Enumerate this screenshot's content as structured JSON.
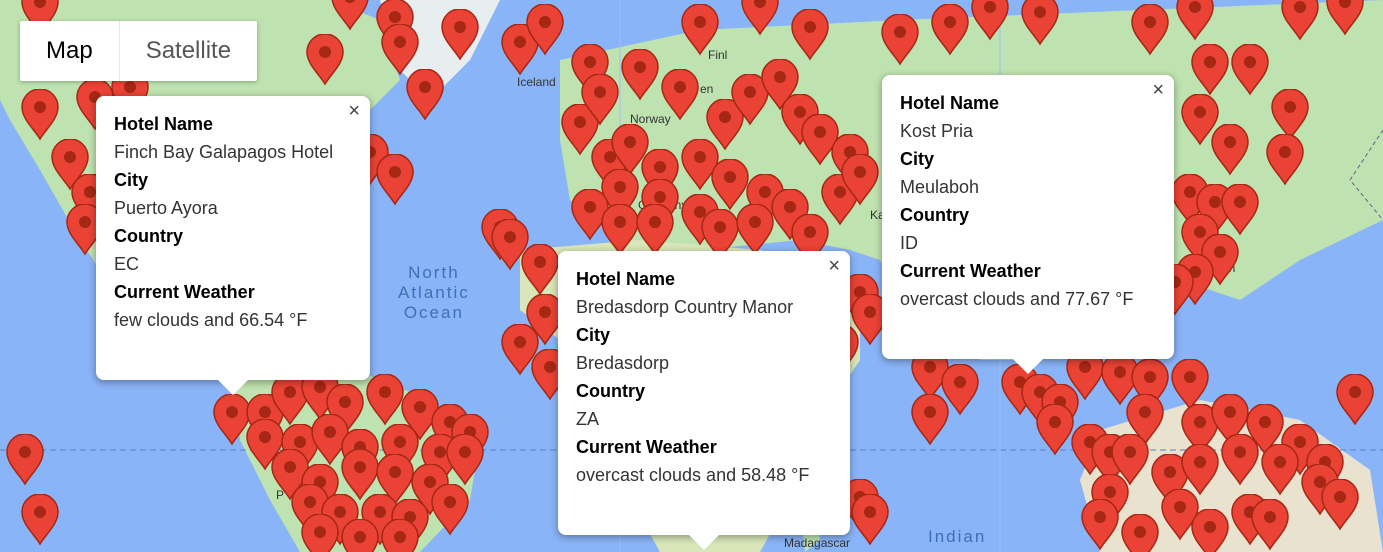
{
  "map_type": {
    "map_label": "Map",
    "satellite_label": "Satellite"
  },
  "labels": {
    "north_atlantic": [
      "North",
      "Atlantic",
      "Ocean"
    ],
    "indian": "Indian",
    "iceland": "Iceland",
    "norway": "Norway",
    "germany": "Germany",
    "madagascar": "Madagascar",
    "finland": "Finl",
    "sweden": "en",
    "kaz": "Ka",
    "china": "an",
    "peru": "P"
  },
  "colors": {
    "water": "#8ab4f8",
    "land": "#bfe3b0",
    "land_dry": "#e8e2cf",
    "marker": "#ea4335",
    "marker_dark": "#a52714"
  },
  "info_windows": [
    {
      "hotel_label": "Hotel Name",
      "hotel": "Finch Bay Galapagos Hotel",
      "city_label": "City",
      "city": "Puerto Ayora",
      "country_label": "Country",
      "country": "EC",
      "weather_label": "Current Weather",
      "weather": "few clouds and 66.54 °F",
      "close": "×"
    },
    {
      "hotel_label": "Hotel Name",
      "hotel": "Bredasdorp Country Manor",
      "city_label": "City",
      "city": "Bredasdorp",
      "country_label": "Country",
      "country": "ZA",
      "weather_label": "Current Weather",
      "weather": "overcast clouds and 58.48 °F",
      "close": "×"
    },
    {
      "hotel_label": "Hotel Name",
      "hotel": "Kost Pria",
      "city_label": "City",
      "city": "Meulaboh",
      "country_label": "Country",
      "country": "ID",
      "weather_label": "Current Weather",
      "weather": "overcast clouds and 77.67 °F",
      "close": "×"
    }
  ]
}
